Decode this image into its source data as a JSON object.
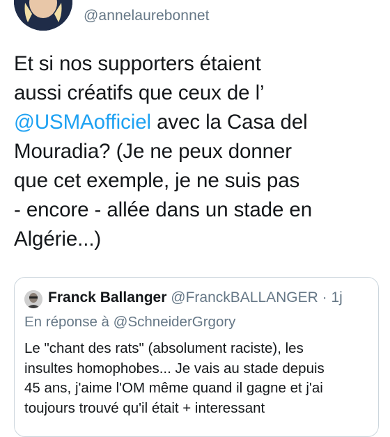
{
  "tweet": {
    "handle": "@annelaurebonnet",
    "text_lines": [
      "Et si nos supporters étaient",
      "aussi créatifs que ceux de l’",
      "avec la Casa del",
      "Mouradia? (Je ne peux donner",
      "que cet exemple, je ne suis pas",
      "- encore - allée dans un stade en",
      "Algérie...)"
    ],
    "mention": "@USMAofficiel"
  },
  "quoted": {
    "name": "Franck Ballanger",
    "handle": "@FranckBALLANGER",
    "separator": "·",
    "time": "1j",
    "reply_prefix": "En réponse à",
    "reply_mention": "@SchneiderGrgory",
    "text_lines": [
      "Le \"chant des rats\" (absolument raciste), les",
      "insultes homophobes... Je vais au stade depuis",
      "45 ans, j'aime l'OM même quand il gagne et j'ai",
      "toujours trouvé qu'il était + interessant"
    ]
  },
  "colors": {
    "link": "#1da1f2",
    "secondary_text": "#657786",
    "primary_text": "#14171a",
    "border": "#ccd6dd"
  }
}
